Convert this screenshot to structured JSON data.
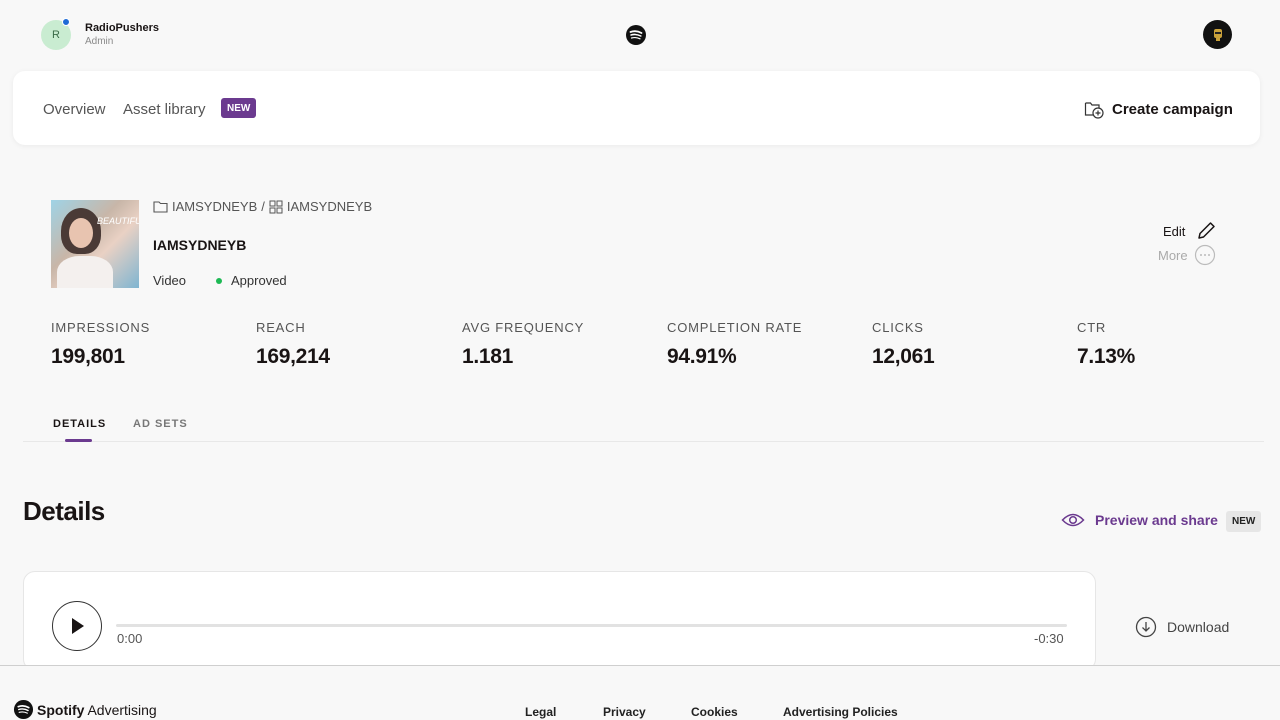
{
  "account": {
    "initial": "R",
    "name": "RadioPushers",
    "role": "Admin"
  },
  "nav": {
    "overview": "Overview",
    "asset_library": "Asset library",
    "new_badge": "NEW",
    "create_campaign": "Create campaign"
  },
  "ad": {
    "thumbnail_text": "BEAUTIFUL",
    "campaign": "IAMSYDNEYB",
    "separator": "/",
    "ad_set": "IAMSYDNEYB",
    "title": "IAMSYDNEYB",
    "format": "Video",
    "status": "Approved",
    "status_color": "#1db954"
  },
  "actions": {
    "edit": "Edit",
    "more": "More"
  },
  "stats": [
    {
      "label": "IMPRESSIONS",
      "value": "199,801"
    },
    {
      "label": "REACH",
      "value": "169,214"
    },
    {
      "label": "AVG FREQUENCY",
      "value": "1.181"
    },
    {
      "label": "COMPLETION RATE",
      "value": "94.91%"
    },
    {
      "label": "CLICKS",
      "value": "12,061"
    },
    {
      "label": "CTR",
      "value": "7.13%"
    }
  ],
  "tabs": [
    {
      "label": "DETAILS",
      "active": true
    },
    {
      "label": "AD SETS",
      "active": false
    }
  ],
  "details": {
    "title": "Details",
    "preview_share": "Preview and share",
    "preview_badge": "NEW"
  },
  "player": {
    "current_time": "0:00",
    "remaining_time": "-0:30",
    "progress": 0
  },
  "download": "Download",
  "footer": {
    "brand": "Spotify",
    "brand_suffix": "Advertising",
    "links": [
      "Legal",
      "Privacy",
      "Cookies",
      "Advertising Policies"
    ]
  },
  "colors": {
    "accent": "#6b3a8f",
    "approved": "#1db954"
  }
}
